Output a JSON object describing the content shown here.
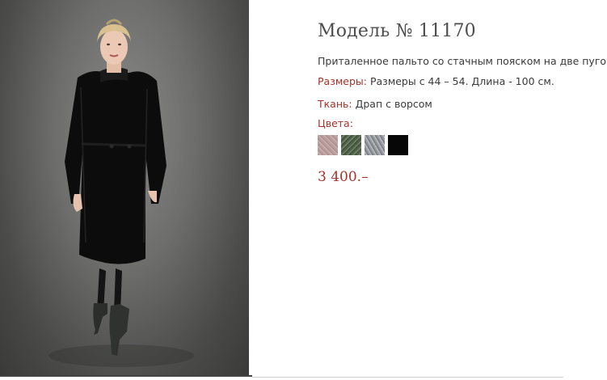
{
  "product": {
    "title": "Модель № 11170",
    "description": "Приталенное пальто со стачным пояском на две пуговки.",
    "sizes_label": "Размеры:",
    "sizes_value": "Размеры с 44 – 54. Длина - 100 см.",
    "fabric_label": "Ткань:",
    "fabric_value": "Драп с ворсом",
    "colors_label": "Цвета:",
    "colors": [
      {
        "name": "pink-swatch",
        "hex": "#b89a9a"
      },
      {
        "name": "green-swatch",
        "hex": "#56674e"
      },
      {
        "name": "gray-swatch",
        "hex": "#a3a6ab"
      },
      {
        "name": "black-swatch",
        "hex": "#070707"
      }
    ],
    "price": "3 400.–"
  },
  "accent_color": "#a6322a"
}
